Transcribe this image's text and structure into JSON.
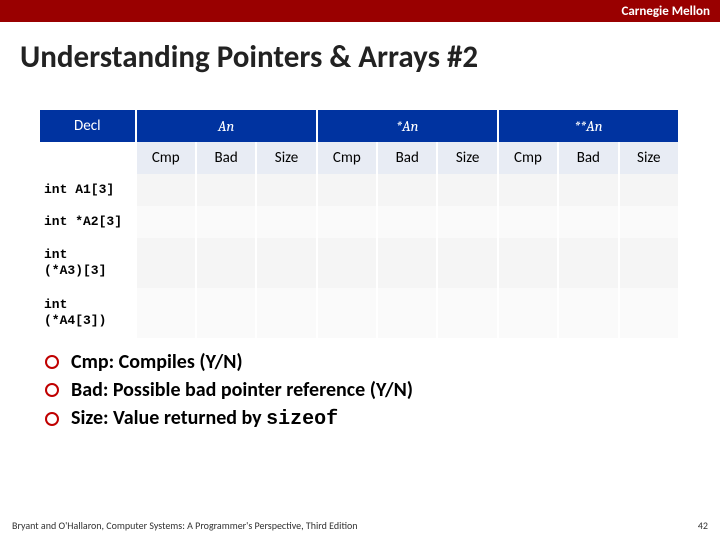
{
  "brand": "Carnegie Mellon",
  "title": "Understanding Pointers & Arrays #2",
  "table": {
    "decl_header": "Decl",
    "groups": [
      "An",
      "*An",
      "**An"
    ],
    "subheaders": [
      "Cmp",
      "Bad",
      "Size"
    ],
    "rows": [
      {
        "decl": "int A1[3]"
      },
      {
        "decl": "int *A2[3]"
      },
      {
        "decl": "int\n(*A3)[3]"
      },
      {
        "decl": "int\n(*A4[3])"
      }
    ]
  },
  "legend": [
    {
      "label": "Cmp: Compiles (Y/N)"
    },
    {
      "label_parts": [
        "Bad: Possible bad pointer reference (Y/N)"
      ]
    },
    {
      "label_parts": [
        "Size: Value returned by ",
        {
          "code": "sizeof"
        }
      ]
    }
  ],
  "footer": {
    "left": "Bryant and O'Hallaron, Computer Systems: A Programmer's Perspective, Third Edition",
    "right": "42"
  }
}
